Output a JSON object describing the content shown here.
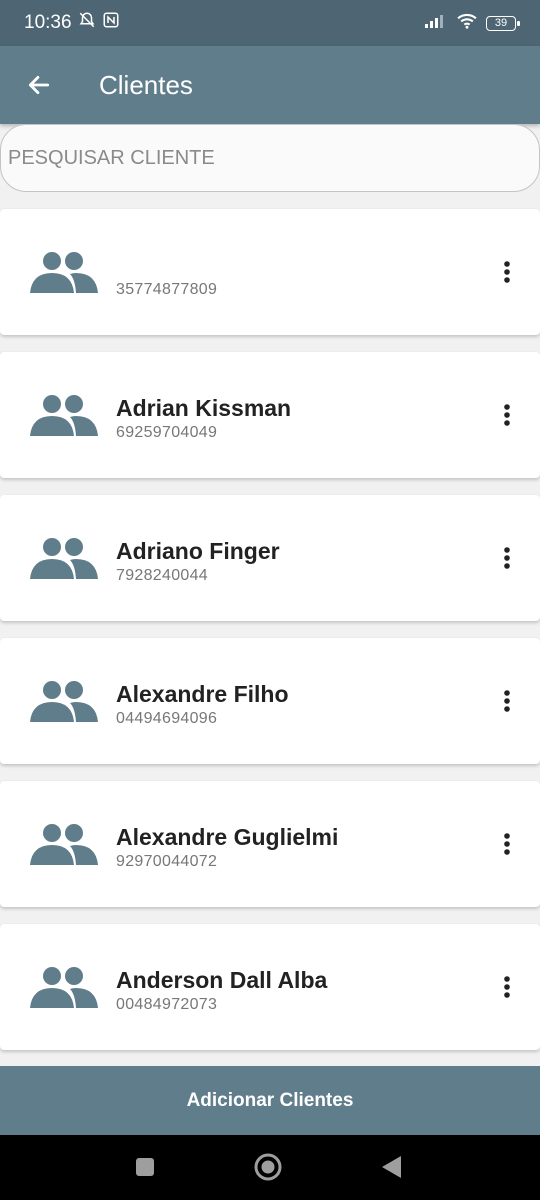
{
  "status_bar": {
    "time": "10:36",
    "battery": "39",
    "icons": [
      "bell-off-icon",
      "nfc-icon",
      "signal-icon",
      "wifi-icon",
      "battery-icon"
    ]
  },
  "app_bar": {
    "title": "Clientes",
    "back_icon": "arrow-left-icon"
  },
  "search": {
    "placeholder": "PESQUISAR CLIENTE",
    "value": ""
  },
  "clients": [
    {
      "name": "",
      "document": "35774877809"
    },
    {
      "name": "Adrian Kissman",
      "document": "69259704049"
    },
    {
      "name": "Adriano Finger",
      "document": "7928240044"
    },
    {
      "name": "Alexandre Filho",
      "document": "04494694096"
    },
    {
      "name": "Alexandre Guglielmi",
      "document": "92970044072"
    },
    {
      "name": "Anderson Dall Alba",
      "document": "00484972073"
    }
  ],
  "bottom_button": {
    "label": "Adicionar Clientes"
  },
  "colors": {
    "status_bar": "#4e6673",
    "app_bar": "#607d8b",
    "icon": "#607d8b"
  }
}
